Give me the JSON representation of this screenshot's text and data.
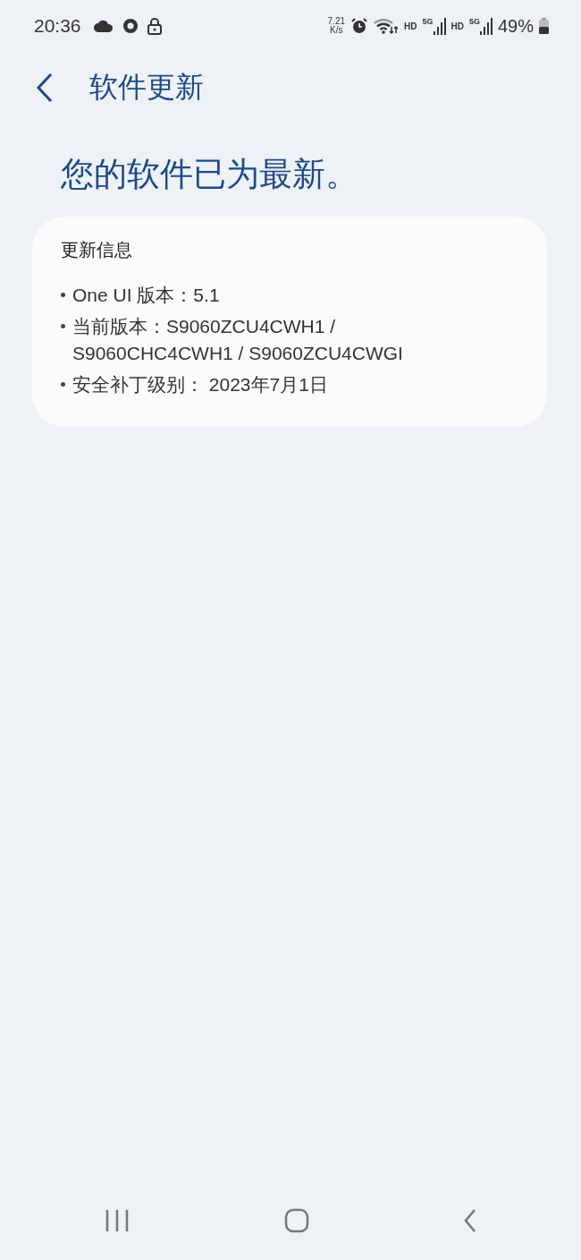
{
  "status_bar": {
    "time": "20:36",
    "speed_value": "7.21",
    "speed_unit": "K/s",
    "sims": [
      {
        "hd": "HD",
        "network": "5G"
      },
      {
        "hd": "HD",
        "network": "5G"
      }
    ],
    "battery": "49%"
  },
  "header": {
    "title": "软件更新"
  },
  "headline": "您的软件已为最新。",
  "card": {
    "title": "更新信息",
    "items": [
      "One UI 版本：5.1",
      "当前版本：S9060ZCU4CWH1 / S9060CHC4CWH1 / S9060ZCU4CWGI",
      "安全补丁级别： 2023年7月1日"
    ]
  }
}
